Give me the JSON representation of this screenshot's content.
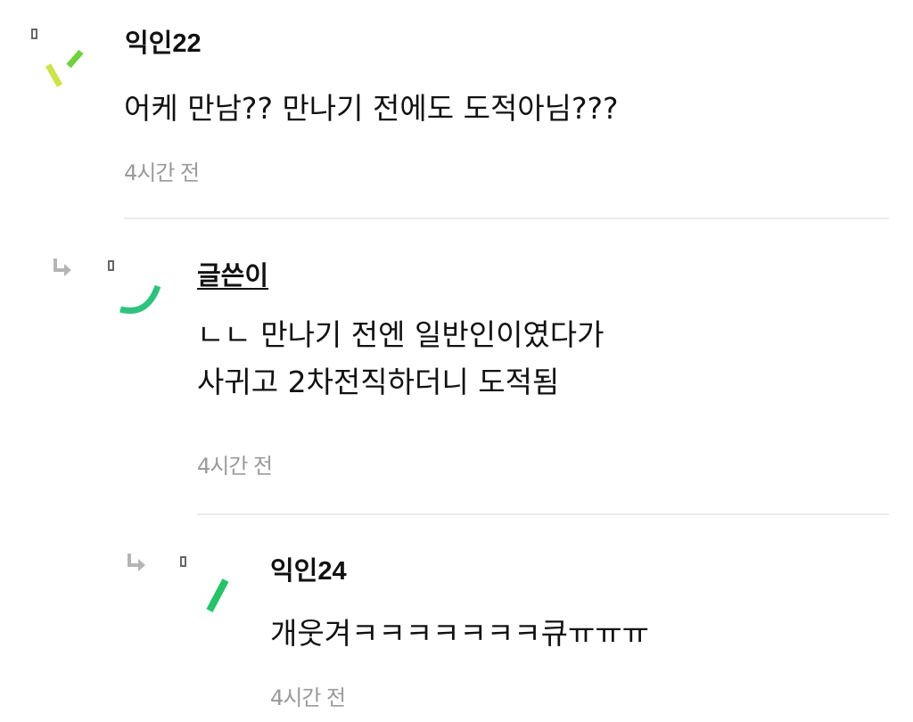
{
  "comments": [
    {
      "author": "익인22",
      "lines": [
        "어케 만남?? 만나기 전에도 도적아님???"
      ],
      "time": "4시간 전",
      "avatar_colors": [
        "#cfe24a",
        "#6fd13e"
      ]
    },
    {
      "author": "글쓴이",
      "lines": [
        "ㄴㄴ 만나기 전엔 일반인이였다가",
        "사귀고 2차전직하더니 도적됨"
      ],
      "time": "4시간 전",
      "avatar_colors": [
        "#2ec27e"
      ],
      "reply_icon": "reply-arrow-icon"
    },
    {
      "author": "익인24",
      "lines": [
        "개웃겨ㅋㅋㅋㅋㅋㅋㅋ큐ㅠㅠㅠ"
      ],
      "time": "4시간 전",
      "avatar_colors": [
        "#27c26a"
      ],
      "reply_icon": "reply-arrow-icon"
    }
  ],
  "colors": {
    "divider": "#ebebeb",
    "time": "#9a9a9a",
    "reply_arrow": "#b5b5b5"
  }
}
